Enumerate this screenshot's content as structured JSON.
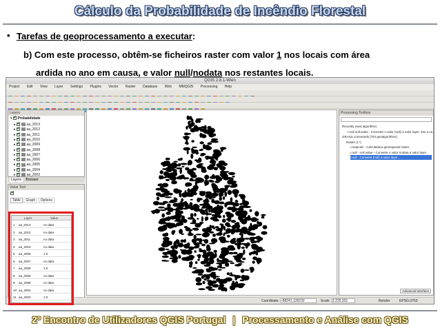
{
  "slide": {
    "title": "Cálculo da Probabilidade de Incêndio Florestal",
    "bullet_glyph": "•",
    "bullet_label": "Tarefas de geoprocessamento a executar",
    "bullet_colon": ":",
    "para_line1_pre": "b) Com este processo, obtêm-se ficheiros raster com valor ",
    "para_line1_value": "1",
    "para_line1_post": " nos locais com área",
    "para_line2_pre": "ardida no ano em causa, e valor ",
    "para_line2_null": "null",
    "para_line2_slash": "/",
    "para_line2_nodata": "nodata",
    "para_line2_post": " nos restantes locais."
  },
  "qgis": {
    "window_title": "QGIS 2.8.1-Wien",
    "menu": [
      "Project",
      "Edit",
      "View",
      "Layer",
      "Settings",
      "Plugins",
      "Vector",
      "Raster",
      "Database",
      "Web",
      "MMQGIS",
      "Processing",
      "Help"
    ],
    "layers_panel_title": "Layers",
    "layer_group": "Probabilidade",
    "layers": [
      "aa_2013",
      "aa_2012",
      "aa_2011",
      "aa_2010",
      "aa_2009",
      "aa_2008",
      "aa_2007",
      "aa_2006",
      "aa_2005",
      "aa_2004",
      "aa_2003"
    ],
    "panel_tabs": [
      "Layers",
      "Browser"
    ],
    "identify_title": "Value Tool",
    "identify_tabs": [
      "Table",
      "Graph",
      "Options"
    ],
    "table_headers": [
      "Layer",
      "Value"
    ],
    "table_rows": [
      {
        "layer": "aa_2013",
        "value": "no data"
      },
      {
        "layer": "aa_2012",
        "value": "no data"
      },
      {
        "layer": "aa_2011",
        "value": "no data"
      },
      {
        "layer": "aa_2010",
        "value": "no data"
      },
      {
        "layer": "aa_2009",
        "value": "1.0"
      },
      {
        "layer": "aa_2007",
        "value": "no data"
      },
      {
        "layer": "aa_2008",
        "value": "1.0"
      },
      {
        "layer": "aa_2006",
        "value": "no data"
      },
      {
        "layer": "aa_2005",
        "value": "no data"
      },
      {
        "layer": "aa_2004",
        "value": "no data"
      },
      {
        "layer": "aa_2003",
        "value": "1.0"
      }
    ],
    "proc_title": "Processing Toolbox",
    "proc_items": [
      "Recently used algorithms",
      "r.null.null.value - Converte o valor (null) a valor layer, into a us...",
      "GRASS commands [753 geoalgorithms]",
      "Raster (r.*)",
      "r.mapcalc - Calculadora geoespacial raster",
      "r.null - null.value - Converte o valor nodata a valor layer",
      "r.null - Converts (null) a valor layer ..."
    ],
    "status_coord_label": "Coordinate:",
    "status_coord": "-88241,126232",
    "status_scale_label": "Scale",
    "status_scale": "1:225.331",
    "status_render": "Render",
    "status_crs": "EPSG:3763",
    "advanced_label": "Advanced interface"
  },
  "footer": {
    "left": "2º Encontro de Utilizadores QGIS Portugal",
    "sep": "|",
    "right": "Processamento e Análise com QGIS"
  },
  "colors": {
    "title_fill": "#c6d8f0",
    "title_outline": "#2a3d63",
    "highlight_box": "#e41a1c",
    "footer_fill": "#fff4c2",
    "burned_area": "#000000"
  }
}
